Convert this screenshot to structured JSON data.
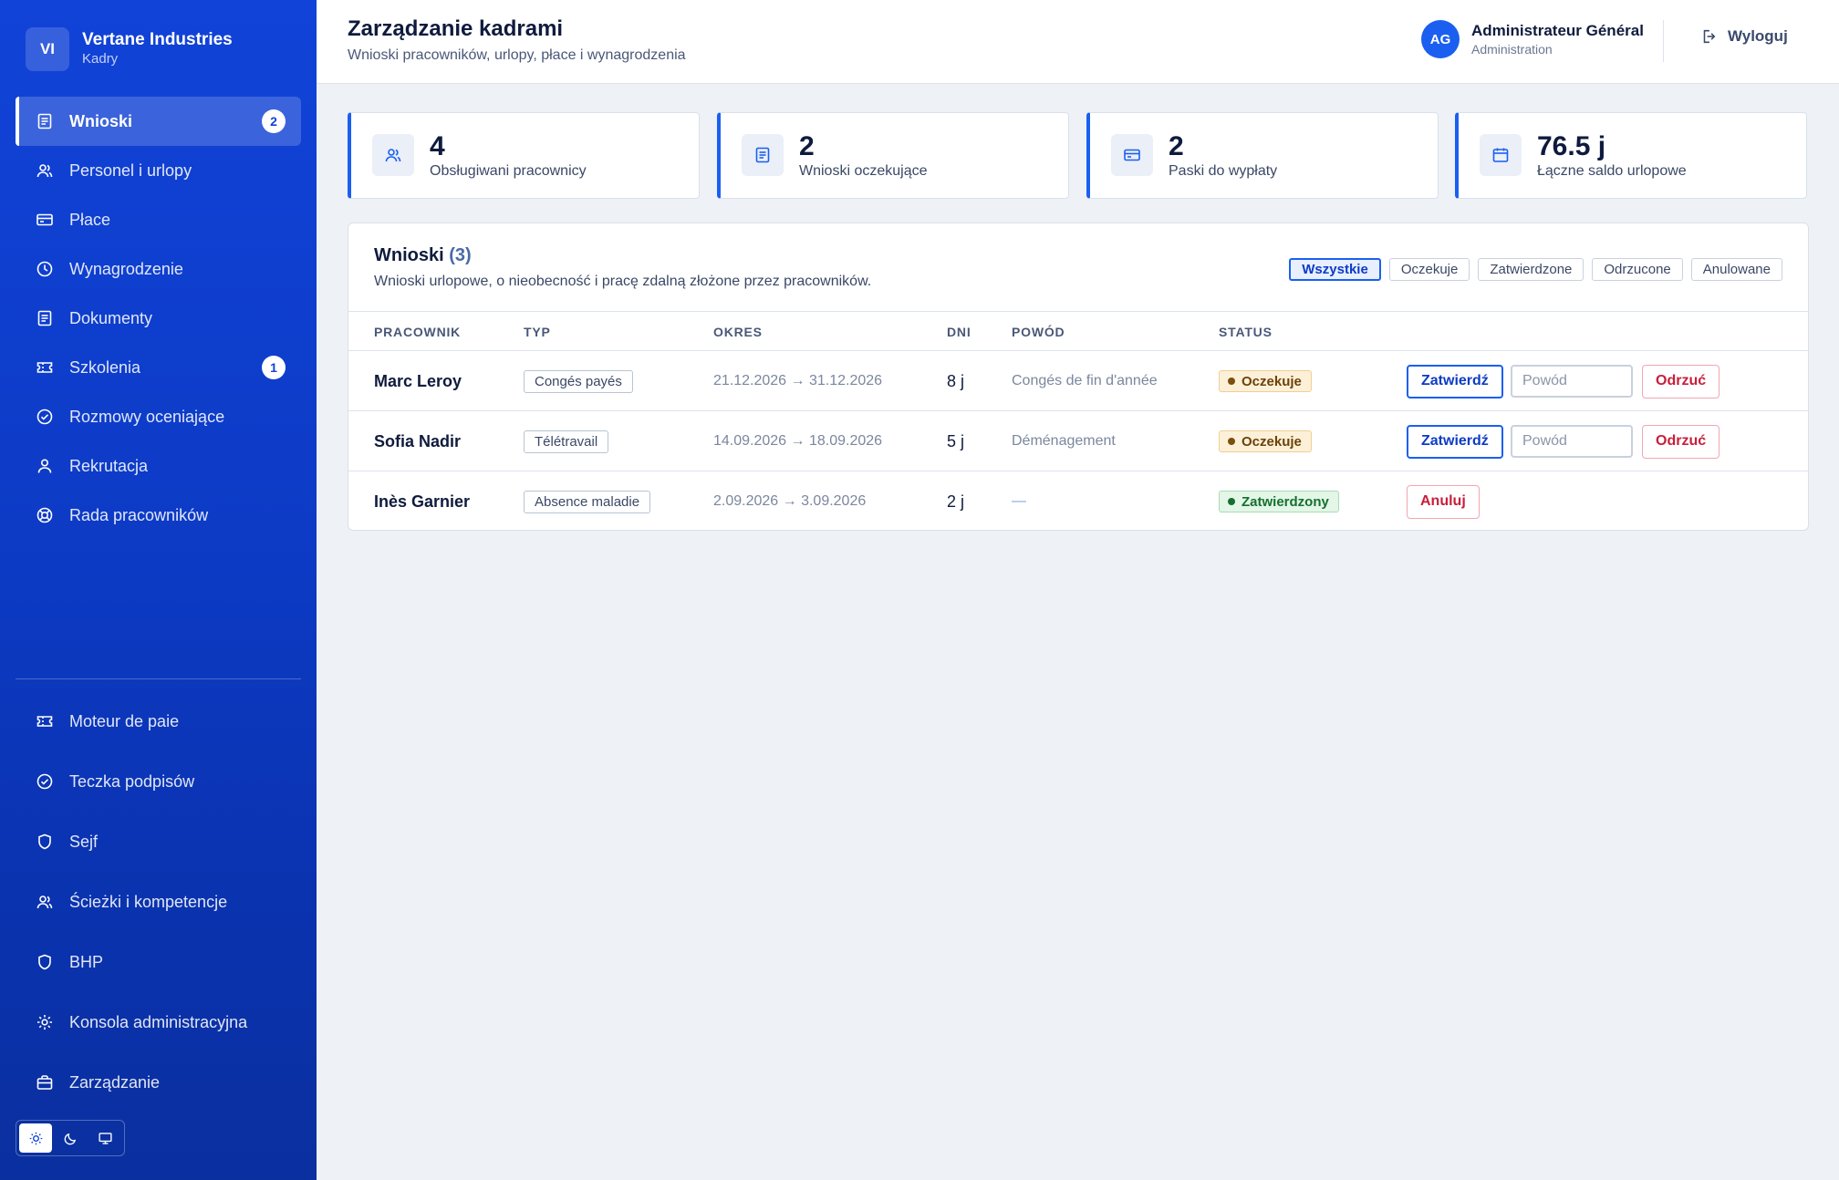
{
  "brand": {
    "initials": "VI",
    "name": "Vertane Industries",
    "subtitle": "Kadry"
  },
  "sidebar": {
    "items": [
      {
        "label": "Wnioski",
        "icon": "document-icon",
        "badge": "2",
        "active": true
      },
      {
        "label": "Personel i urlopy",
        "icon": "users-icon"
      },
      {
        "label": "Płace",
        "icon": "card-icon"
      },
      {
        "label": "Wynagrodzenie",
        "icon": "clock-icon"
      },
      {
        "label": "Dokumenty",
        "icon": "document-icon"
      },
      {
        "label": "Szkolenia",
        "icon": "ticket-icon",
        "badge": "1"
      },
      {
        "label": "Rozmowy oceniające",
        "icon": "check-circle-icon"
      },
      {
        "label": "Rekrutacja",
        "icon": "user-icon"
      },
      {
        "label": "Rada pracowników",
        "icon": "lifebuoy-icon"
      }
    ],
    "secondary_items": [
      {
        "label": "Moteur de paie",
        "icon": "ticket-icon"
      },
      {
        "label": "Teczka podpisów",
        "icon": "check-circle-icon"
      },
      {
        "label": "Sejf",
        "icon": "shield-icon"
      },
      {
        "label": "Ścieżki i kompetencje",
        "icon": "users-icon"
      },
      {
        "label": "BHP",
        "icon": "shield-icon"
      },
      {
        "label": "Konsola administracyjna",
        "icon": "gear-icon"
      },
      {
        "label": "Zarządzanie",
        "icon": "briefcase-icon"
      }
    ],
    "theme_modes": [
      "sun-icon",
      "moon-icon",
      "monitor-icon"
    ]
  },
  "header": {
    "title": "Zarządzanie kadrami",
    "subtitle": "Wnioski pracowników, urlopy, płace i wynagrodzenia",
    "user": {
      "initials": "AG",
      "name": "Administrateur Général",
      "role": "Administration"
    },
    "logout_label": "Wyloguj"
  },
  "stats": [
    {
      "value": "4",
      "label": "Obsługiwani pracownicy",
      "icon": "users-icon"
    },
    {
      "value": "2",
      "label": "Wnioski oczekujące",
      "icon": "document-icon"
    },
    {
      "value": "2",
      "label": "Paski do wypłaty",
      "icon": "card-icon"
    },
    {
      "value": "76.5 j",
      "label": "Łączne saldo urlopowe",
      "icon": "calendar-icon"
    }
  ],
  "requests": {
    "title": "Wnioski",
    "count": "(3)",
    "subtitle": "Wnioski urlopowe, o nieobecność i pracę zdalną złożone przez pracowników.",
    "filters": [
      "Wszystkie",
      "Oczekuje",
      "Zatwierdzone",
      "Odrzucone",
      "Anulowane"
    ],
    "active_filter": "Wszystkie",
    "columns": [
      "PRACOWNIK",
      "TYP",
      "OKRES",
      "DNI",
      "POWÓD",
      "STATUS"
    ],
    "rows": [
      {
        "employee": "Marc Leroy",
        "type": "Congés payés",
        "period": "21.12.2026 → 31.12.2026",
        "days": "8 j",
        "reason": "Congés de fin d'année",
        "status": "Oczekuje",
        "status_kind": "pending",
        "approve_label": "Zatwierdź",
        "reason_placeholder": "Powód",
        "reject_label": "Odrzuć"
      },
      {
        "employee": "Sofia Nadir",
        "type": "Télétravail",
        "period": "14.09.2026 → 18.09.2026",
        "days": "5 j",
        "reason": "Déménagement",
        "status": "Oczekuje",
        "status_kind": "pending",
        "approve_label": "Zatwierdź",
        "reason_placeholder": "Powód",
        "reject_label": "Odrzuć"
      },
      {
        "employee": "Inès Garnier",
        "type": "Absence maladie",
        "period": "2.09.2026 → 3.09.2026",
        "days": "2 j",
        "reason": "—",
        "status": "Zatwierdzony",
        "status_kind": "approved",
        "cancel_label": "Anuluj"
      }
    ]
  },
  "colors": {
    "accent": "#1a5ff0",
    "sidebar": "#0d3bc6",
    "pending": "#fdf0d8",
    "approved": "#e3f6e7",
    "reject": "#c81e3a"
  }
}
